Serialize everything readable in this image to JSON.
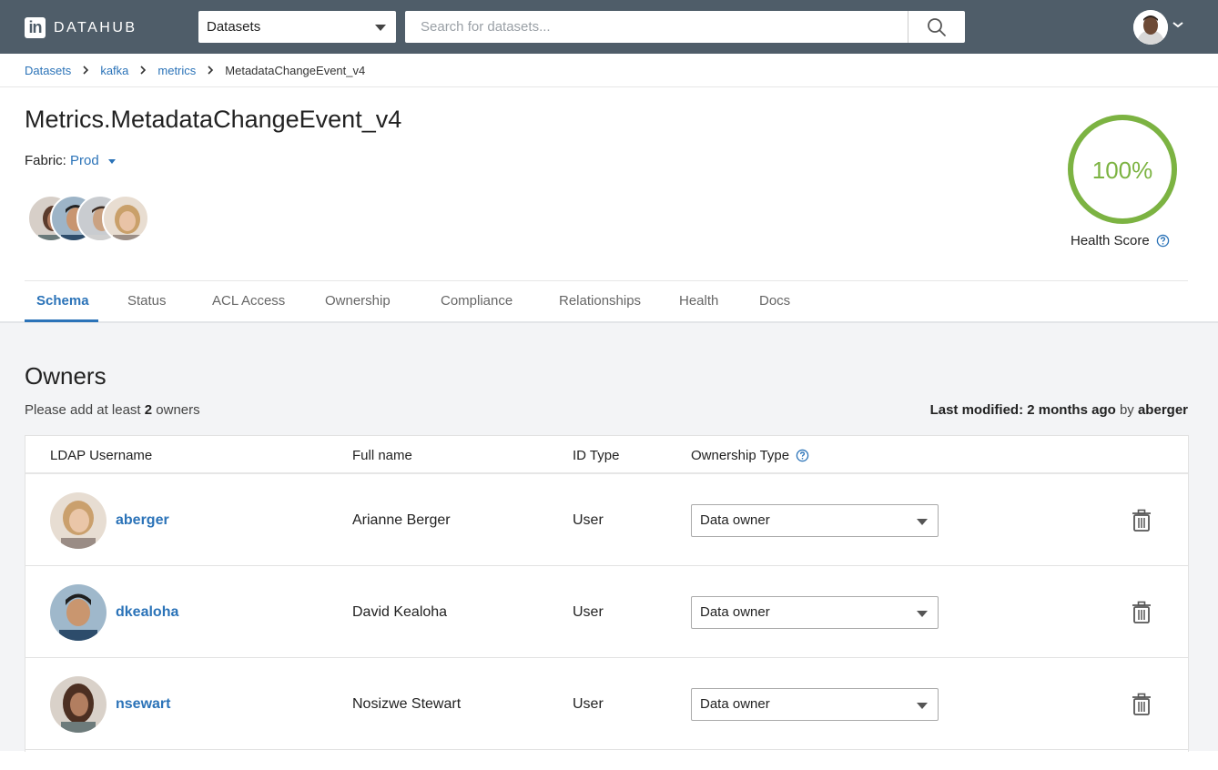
{
  "nav": {
    "logo_mark": "in",
    "logo_text": "DATAHUB",
    "category": "Datasets",
    "search_placeholder": "Search for datasets..."
  },
  "breadcrumb": [
    {
      "label": "Datasets"
    },
    {
      "label": "kafka"
    },
    {
      "label": "metrics"
    },
    {
      "label": "MetadataChangeEvent_v4"
    }
  ],
  "header": {
    "title": "Metrics.MetadataChangeEvent_v4",
    "fabric_label": "Fabric:",
    "fabric_value": "Prod",
    "health_score": "100%",
    "health_label": "Health Score",
    "health_value": 1.0,
    "health_color": "#7cb342"
  },
  "tabs": [
    {
      "label": "Schema",
      "active": true
    },
    {
      "label": "Status"
    },
    {
      "label": "ACL Access"
    },
    {
      "label": "Ownership"
    },
    {
      "label": "Compliance"
    },
    {
      "label": "Relationships"
    },
    {
      "label": "Health"
    },
    {
      "label": "Docs"
    }
  ],
  "owners": {
    "title": "Owners",
    "hint_prefix": "Please add at least",
    "hint_count": "2",
    "hint_suffix": "owners",
    "last_modified_label": "Last modified:",
    "last_modified_value": "2 months ago",
    "last_modified_by_label": "by",
    "last_modified_by": "aberger",
    "columns": {
      "ldap": "LDAP Username",
      "full_name": "Full name",
      "id_type": "ID Type",
      "ownership_type": "Ownership Type"
    },
    "rows": [
      {
        "username": "aberger",
        "full_name": "Arianne Berger",
        "id_type": "User",
        "ownership_type": "Data owner"
      },
      {
        "username": "dkealoha",
        "full_name": "David Kealoha",
        "id_type": "User",
        "ownership_type": "Data owner"
      },
      {
        "username": "nsewart",
        "full_name": "Nosizwe Stewart",
        "id_type": "User",
        "ownership_type": "Data owner"
      }
    ]
  },
  "colors": {
    "nav_bg": "#4f5d69",
    "link": "#2b73b8",
    "health": "#7cb342",
    "content_bg": "#f3f4f6"
  }
}
